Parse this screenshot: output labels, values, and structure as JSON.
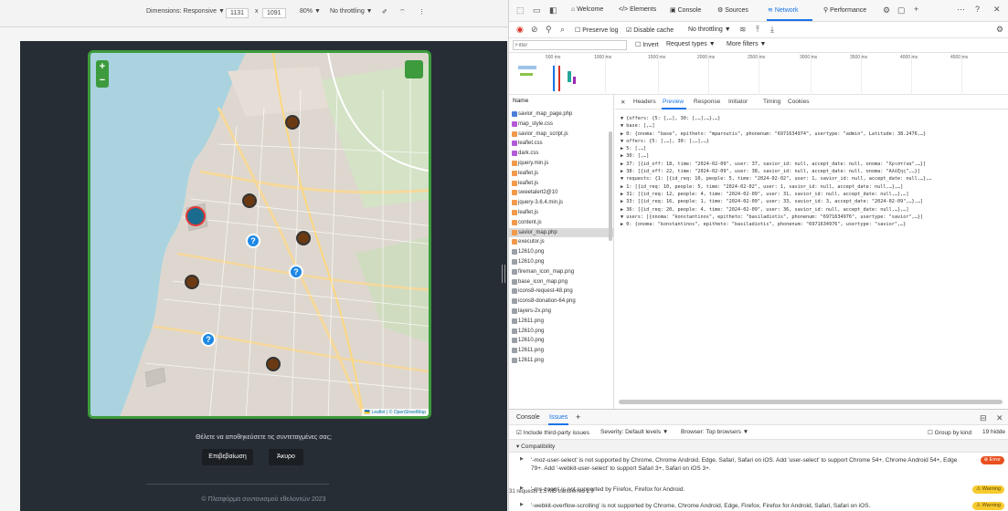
{
  "device_toolbar": {
    "dimensions_label": "Dimensions: Responsive ▼",
    "width": "1131",
    "times": "x",
    "height": "1091",
    "zoom": "80% ▼",
    "throttling": "No throttling ▼"
  },
  "map_page": {
    "zoom_in": "+",
    "zoom_out": "−",
    "attribution": "🇺🇦 Leaflet | © OpenStreetMap",
    "confirm_question": "Θέλετε να αποθηκεύσετε τις συντεταγμένες σας;",
    "confirm_button": "Επιβεβαίωση",
    "cancel_button": "Άκυρο",
    "footer": "© Πλατφόρμα συντονισμού εθελοντών 2023"
  },
  "devtools": {
    "tabs": [
      "Welcome",
      "Elements",
      "Console",
      "Sources",
      "Network",
      "Performance"
    ],
    "active_tab": "Network",
    "toolbar": {
      "preserve_log": "Preserve log",
      "disable_cache": "Disable cache",
      "throttling": "No throttling"
    },
    "filter": {
      "placeholder": "Filter",
      "invert": "Invert",
      "request_types": "Request types ▼",
      "more_filters": "More filters ▼"
    },
    "timeline_ticks": [
      "500 ms",
      "1000 ms",
      "1500 ms",
      "2000 ms",
      "2500 ms",
      "3000 ms",
      "3500 ms",
      "4000 ms",
      "4500 ms"
    ],
    "name_header": "Name",
    "requests": [
      {
        "name": "savior_map_page.php",
        "kind": "doc"
      },
      {
        "name": "map_style.css",
        "kind": "css"
      },
      {
        "name": "savior_map_script.js",
        "kind": "js"
      },
      {
        "name": "leaflet.css",
        "kind": "css"
      },
      {
        "name": "dark.css",
        "kind": "css"
      },
      {
        "name": "jquery.min.js",
        "kind": "js"
      },
      {
        "name": "leaflet.js",
        "kind": "js"
      },
      {
        "name": "leaflet.js",
        "kind": "js"
      },
      {
        "name": "sweetalert2@10",
        "kind": "js"
      },
      {
        "name": "jquery-3.6.4.min.js",
        "kind": "js"
      },
      {
        "name": "leaflet.js",
        "kind": "js"
      },
      {
        "name": "content.js",
        "kind": "js"
      },
      {
        "name": "savior_map.php",
        "kind": "xhr"
      },
      {
        "name": "executor.js",
        "kind": "js"
      },
      {
        "name": "12610.png",
        "kind": "img"
      },
      {
        "name": "12610.png",
        "kind": "img"
      },
      {
        "name": "fireman_icon_map.png",
        "kind": "img"
      },
      {
        "name": "base_icon_map.png",
        "kind": "img"
      },
      {
        "name": "icons8-request-48.png",
        "kind": "img"
      },
      {
        "name": "icons8-donation-64.png",
        "kind": "img"
      },
      {
        "name": "layers-2x.png",
        "kind": "img"
      },
      {
        "name": "12611.png",
        "kind": "img"
      },
      {
        "name": "12610.png",
        "kind": "img"
      },
      {
        "name": "12610.png",
        "kind": "img"
      },
      {
        "name": "12611.png",
        "kind": "img"
      },
      {
        "name": "12611.png",
        "kind": "img"
      }
    ],
    "list_status": "31 requests  1.5 MB transferred  1.9",
    "detail_tabs": [
      "Headers",
      "Preview",
      "Response",
      "Initiator",
      "Timing",
      "Cookies"
    ],
    "active_detail_tab": "Preview",
    "preview_lines": [
      "▼ {offers: {5: [,…], 30: [,…],…},…}",
      "  ▼ base: [,…]",
      "    ▶ 0: {onoma: \"base\", epitheto: \"mparoutis\", phonenum: \"6971634974\", usertype: \"admin\", Latitude: 38.2476,…}",
      "  ▼ offers: {5: [,…], 30: [,…],…}",
      "    ▶ 5: [,…]",
      "    ▶ 30: [,…]",
      "    ▶ 37: [{id_off: 18, time: \"2024-02-09\", user: 37, savior_id: null, accept_date: null, onoma: \"Χριστίνα\",…}]",
      "    ▶ 38: [{id_off: 22, time: \"2024-02-09\", user: 38, savior_id: null, accept_date: null, onoma: \"Αλέξης\",…}]",
      "  ▼ requests: {1: [{id_req: 10, people: 5, time: \"2024-02-02\", user: 1, savior_id: null, accept_date: null,…},…",
      "    ▶ 1: [{id_req: 10, people: 5, time: \"2024-02-02\", user: 1, savior_id: null, accept_date: null,…},…]",
      "    ▶ 31: [{id_req: 12, people: 4, time: \"2024-02-09\", user: 31, savior_id: null, accept_date: null,…},…]",
      "    ▶ 33: [{id_req: 16, people: 1, time: \"2024-02-09\", user: 33, savior_id: 3, accept_date: \"2024-02-09\",…},…]",
      "    ▶ 36: [{id_req: 20, people: 4, time: \"2024-02-09\", user: 36, savior_id: null, accept_date: null,…},…]",
      "  ▼ users: [{onoma: \"konstantinos\", epitheto: \"basiladiotis\", phonenum: \"6971634976\", usertype: \"savior\",…}]",
      "    ▶ 0: {onoma: \"konstantinos\", epitheto: \"basiladiotis\", phonenum: \"6971634976\", usertype: \"savior\",…}"
    ],
    "drawer_tabs": [
      "Console",
      "Issues"
    ],
    "active_drawer_tab": "Issues",
    "issues_toolbar": {
      "third_party": "Include third-party issues",
      "severity": "Severity: Default levels ▼",
      "browser": "Browser: Top browsers ▼",
      "group_by_kind": "Group by kind",
      "hidden": "19 hidde"
    },
    "compat_header": "▾ Compatibility",
    "issues": [
      {
        "text": "'-moz-user-select' is not supported by Chrome, Chrome Android, Edge, Safari, Safari on iOS. Add 'user-select' to support Chrome 54+, Chrome Android 54+, Edge 79+. Add '-webkit-user-select' to support Safari 3+, Safari on iOS 3+.",
        "badge": "⊗ Error",
        "level": "error"
      },
      {
        "text": "'-ms-zoom' is not supported by Firefox, Firefox for Android.",
        "badge": "⚠ Warning",
        "level": "warning"
      },
      {
        "text": "'-webkit-overflow-scrolling' is not supported by Chrome, Chrome Android, Edge, Firefox, Firefox for Android, Safari, Safari on iOS.",
        "badge": "⚠ Warning",
        "level": "warning"
      }
    ]
  },
  "colors": {
    "map_border": "#3d9b3d",
    "page_bg": "#272d35",
    "accent": "#1a73e8"
  }
}
